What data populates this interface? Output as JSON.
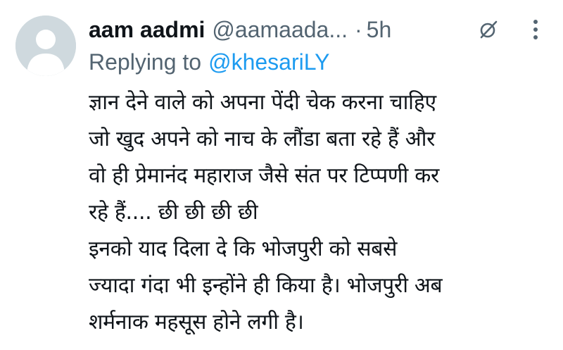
{
  "tweet": {
    "author_name": "aam aadmi",
    "author_handle": "@aamaada...",
    "separator": "·",
    "timestamp": "5h",
    "edited_icon": "edited-icon",
    "more_icon": "more-vertical-icon",
    "reply_prefix": "Replying to",
    "reply_user": "@khesariLY",
    "lines": [
      "ज्ञान देने वाले को अपना पेंदी चेक करना चाहिए",
      "जो खुद अपने को नाच के लौंडा बता रहे हैं और",
      "वो ही प्रेमानंद महाराज जैसे संत पर टिप्पणी कर",
      "रहे हैं.... छी छी छी छी",
      "इनको याद दिला दे कि भोजपुरी को सबसे",
      "ज्यादा गंदा भी इन्होंने ही किया है। भोजपुरी अब",
      "शर्मनाक महसूस होने लगी है।"
    ]
  },
  "colors": {
    "text": "#0f1419",
    "secondary": "#536471",
    "accent": "#1d9bf0",
    "avatar_bg": "#cfd9de",
    "avatar_fg": "#ffffff"
  }
}
